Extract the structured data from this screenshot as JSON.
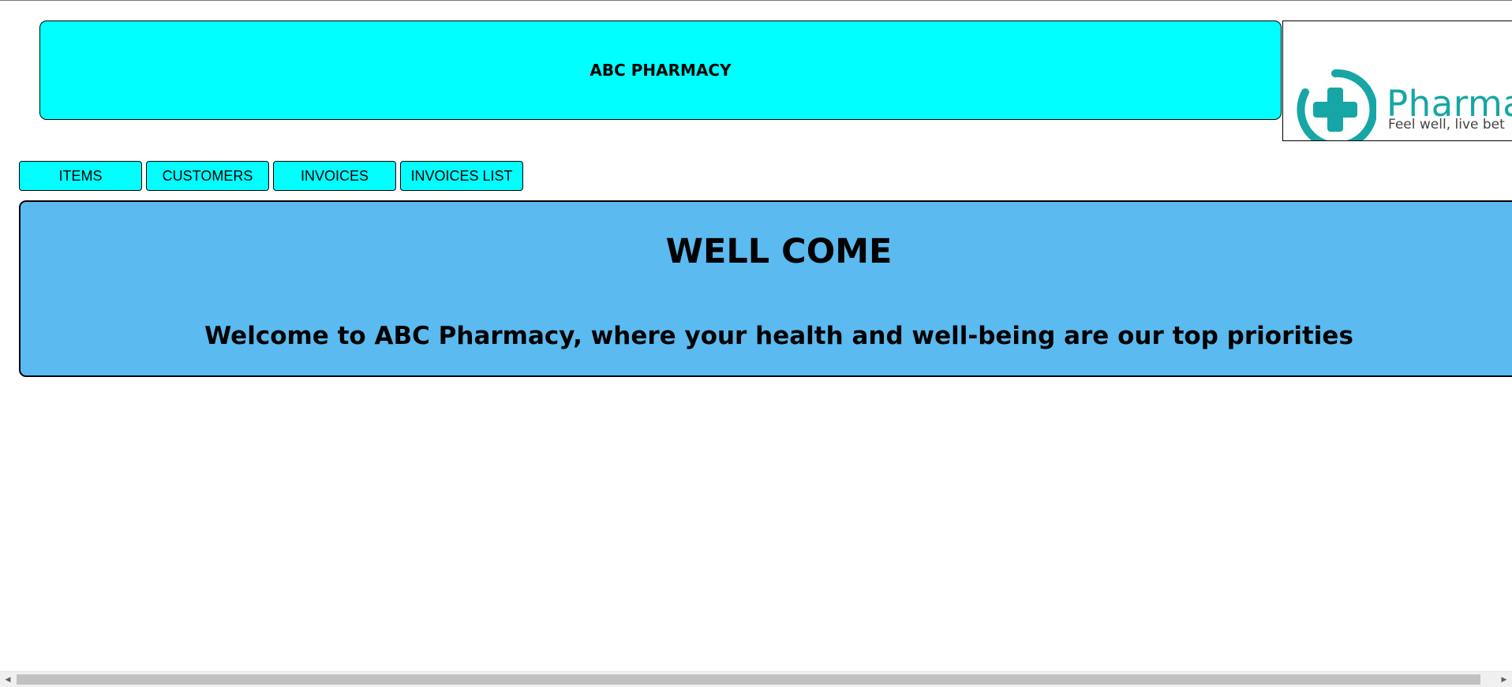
{
  "header": {
    "title": "ABC PHARMACY",
    "logo": {
      "icon": "medical-cross-icon",
      "wordmark": "Pharma",
      "tagline": "Feel well, live bet",
      "color": "#16a6a5"
    }
  },
  "nav": {
    "items": [
      "ITEMS",
      "CUSTOMERS",
      "INVOICES",
      "INVOICES LIST"
    ]
  },
  "welcome": {
    "title": "WELL COME",
    "subtitle": "Welcome to ABC Pharmacy, where your health and well-being are our top priorities"
  },
  "colors": {
    "header_bg": "#00ffff",
    "nav_bg": "#00ffff",
    "welcome_bg": "#5bbaef"
  },
  "scrollbar": {
    "left_icon": "chevron-left-icon",
    "right_icon": "chevron-right-icon"
  }
}
